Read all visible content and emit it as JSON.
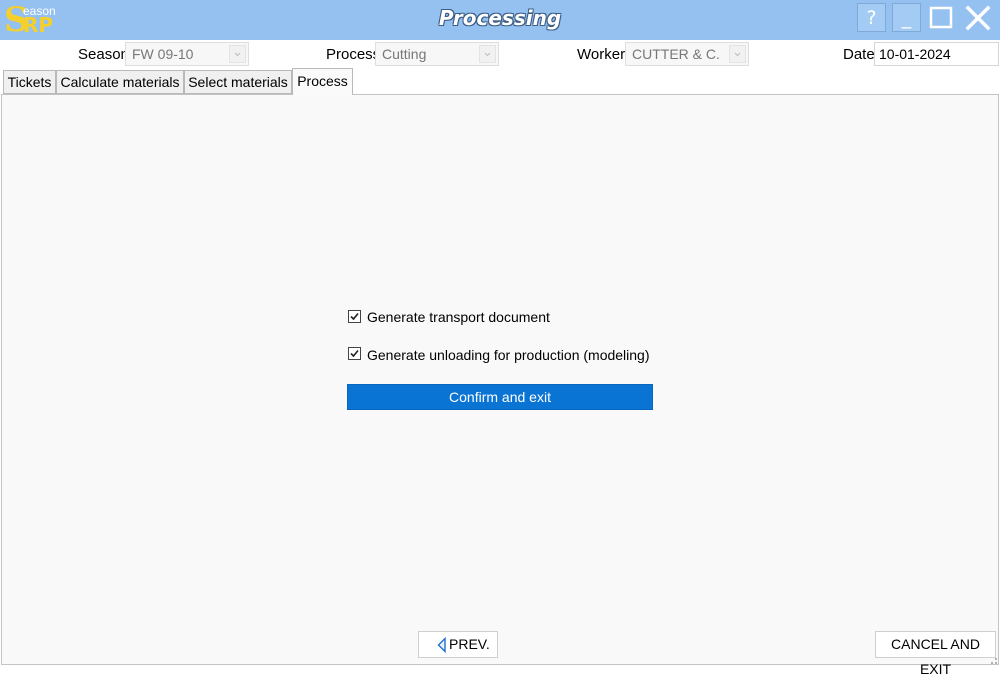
{
  "window": {
    "title": "Processing",
    "logo": {
      "big": "S",
      "top": "eason",
      "bottom": "RP"
    },
    "buttons": {
      "help_label": "?",
      "minimize_label": "_"
    }
  },
  "header": {
    "season_label": "Season",
    "season_value": "FW 09-10",
    "process_label": "Process",
    "process_value": "Cutting",
    "worker_label": "Worker",
    "worker_value": "CUTTER & C.",
    "date_label": "Date",
    "date_value": "10-01-2024"
  },
  "tabs": [
    {
      "label": "Tickets",
      "active": false
    },
    {
      "label": "Calculate materials",
      "active": false
    },
    {
      "label": "Select materials",
      "active": false
    },
    {
      "label": "Process",
      "active": true
    }
  ],
  "process_panel": {
    "options": [
      {
        "label": "Generate transport document",
        "checked": true
      },
      {
        "label": "Generate unloading for production (modeling)",
        "checked": true
      }
    ],
    "confirm_label": "Confirm and exit"
  },
  "footer": {
    "prev_label": "PREV.",
    "cancel_label": "CANCEL AND EXIT"
  },
  "colors": {
    "titlebar": "#94c1f0",
    "accent": "#0a74d4",
    "logo": "#f5cf2b"
  },
  "icons": {
    "help": "question-icon",
    "minimize": "minimize-icon",
    "maximize": "maximize-icon",
    "close": "close-icon",
    "prev": "triangle-left-icon",
    "dropdown": "chevron-down-icon",
    "check": "checkmark-icon"
  }
}
